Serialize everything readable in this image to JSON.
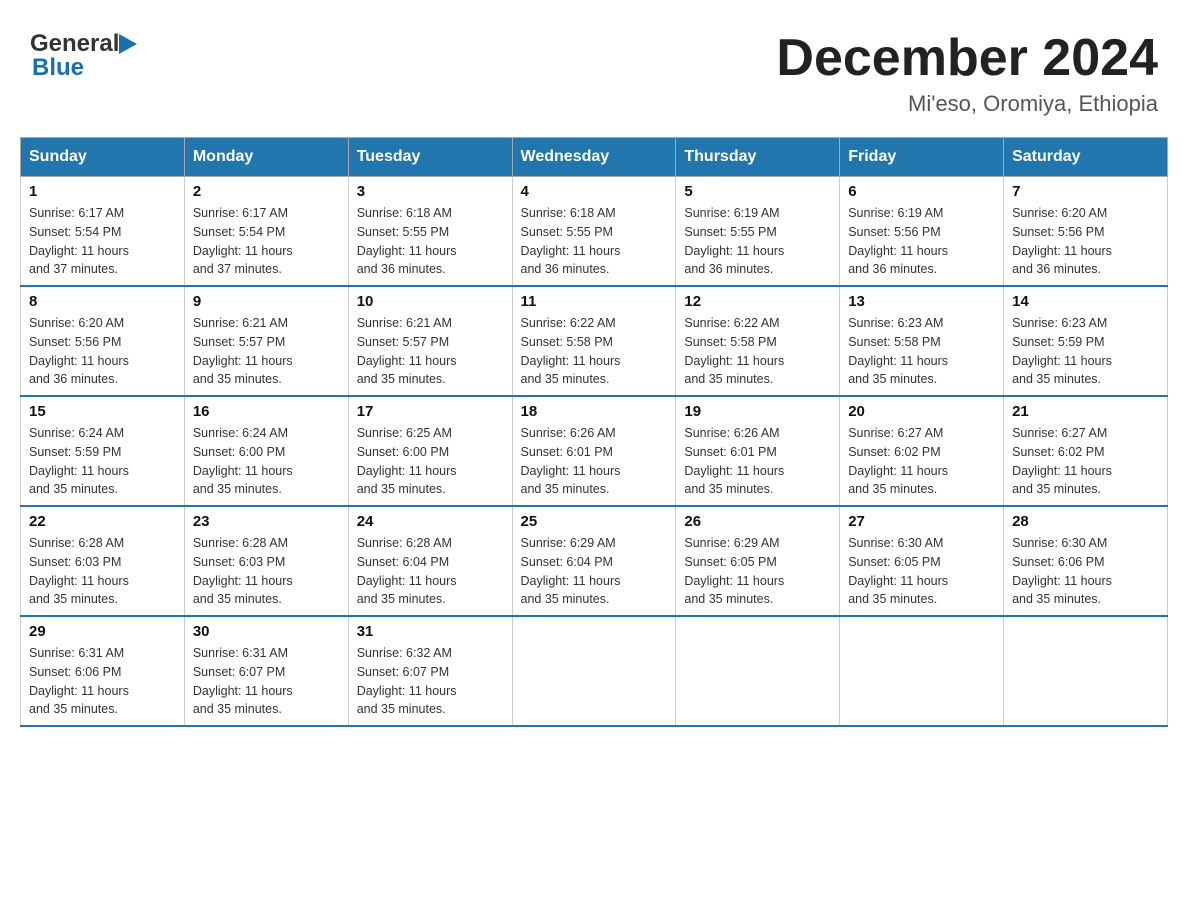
{
  "header": {
    "logo": {
      "general": "General",
      "blue": "Blue"
    },
    "title": "December 2024",
    "subtitle": "Mi'eso, Oromiya, Ethiopia"
  },
  "calendar": {
    "days_of_week": [
      "Sunday",
      "Monday",
      "Tuesday",
      "Wednesday",
      "Thursday",
      "Friday",
      "Saturday"
    ],
    "weeks": [
      [
        {
          "day": "1",
          "sunrise": "6:17 AM",
          "sunset": "5:54 PM",
          "daylight": "11 hours and 37 minutes."
        },
        {
          "day": "2",
          "sunrise": "6:17 AM",
          "sunset": "5:54 PM",
          "daylight": "11 hours and 37 minutes."
        },
        {
          "day": "3",
          "sunrise": "6:18 AM",
          "sunset": "5:55 PM",
          "daylight": "11 hours and 36 minutes."
        },
        {
          "day": "4",
          "sunrise": "6:18 AM",
          "sunset": "5:55 PM",
          "daylight": "11 hours and 36 minutes."
        },
        {
          "day": "5",
          "sunrise": "6:19 AM",
          "sunset": "5:55 PM",
          "daylight": "11 hours and 36 minutes."
        },
        {
          "day": "6",
          "sunrise": "6:19 AM",
          "sunset": "5:56 PM",
          "daylight": "11 hours and 36 minutes."
        },
        {
          "day": "7",
          "sunrise": "6:20 AM",
          "sunset": "5:56 PM",
          "daylight": "11 hours and 36 minutes."
        }
      ],
      [
        {
          "day": "8",
          "sunrise": "6:20 AM",
          "sunset": "5:56 PM",
          "daylight": "11 hours and 36 minutes."
        },
        {
          "day": "9",
          "sunrise": "6:21 AM",
          "sunset": "5:57 PM",
          "daylight": "11 hours and 35 minutes."
        },
        {
          "day": "10",
          "sunrise": "6:21 AM",
          "sunset": "5:57 PM",
          "daylight": "11 hours and 35 minutes."
        },
        {
          "day": "11",
          "sunrise": "6:22 AM",
          "sunset": "5:58 PM",
          "daylight": "11 hours and 35 minutes."
        },
        {
          "day": "12",
          "sunrise": "6:22 AM",
          "sunset": "5:58 PM",
          "daylight": "11 hours and 35 minutes."
        },
        {
          "day": "13",
          "sunrise": "6:23 AM",
          "sunset": "5:58 PM",
          "daylight": "11 hours and 35 minutes."
        },
        {
          "day": "14",
          "sunrise": "6:23 AM",
          "sunset": "5:59 PM",
          "daylight": "11 hours and 35 minutes."
        }
      ],
      [
        {
          "day": "15",
          "sunrise": "6:24 AM",
          "sunset": "5:59 PM",
          "daylight": "11 hours and 35 minutes."
        },
        {
          "day": "16",
          "sunrise": "6:24 AM",
          "sunset": "6:00 PM",
          "daylight": "11 hours and 35 minutes."
        },
        {
          "day": "17",
          "sunrise": "6:25 AM",
          "sunset": "6:00 PM",
          "daylight": "11 hours and 35 minutes."
        },
        {
          "day": "18",
          "sunrise": "6:26 AM",
          "sunset": "6:01 PM",
          "daylight": "11 hours and 35 minutes."
        },
        {
          "day": "19",
          "sunrise": "6:26 AM",
          "sunset": "6:01 PM",
          "daylight": "11 hours and 35 minutes."
        },
        {
          "day": "20",
          "sunrise": "6:27 AM",
          "sunset": "6:02 PM",
          "daylight": "11 hours and 35 minutes."
        },
        {
          "day": "21",
          "sunrise": "6:27 AM",
          "sunset": "6:02 PM",
          "daylight": "11 hours and 35 minutes."
        }
      ],
      [
        {
          "day": "22",
          "sunrise": "6:28 AM",
          "sunset": "6:03 PM",
          "daylight": "11 hours and 35 minutes."
        },
        {
          "day": "23",
          "sunrise": "6:28 AM",
          "sunset": "6:03 PM",
          "daylight": "11 hours and 35 minutes."
        },
        {
          "day": "24",
          "sunrise": "6:28 AM",
          "sunset": "6:04 PM",
          "daylight": "11 hours and 35 minutes."
        },
        {
          "day": "25",
          "sunrise": "6:29 AM",
          "sunset": "6:04 PM",
          "daylight": "11 hours and 35 minutes."
        },
        {
          "day": "26",
          "sunrise": "6:29 AM",
          "sunset": "6:05 PM",
          "daylight": "11 hours and 35 minutes."
        },
        {
          "day": "27",
          "sunrise": "6:30 AM",
          "sunset": "6:05 PM",
          "daylight": "11 hours and 35 minutes."
        },
        {
          "day": "28",
          "sunrise": "6:30 AM",
          "sunset": "6:06 PM",
          "daylight": "11 hours and 35 minutes."
        }
      ],
      [
        {
          "day": "29",
          "sunrise": "6:31 AM",
          "sunset": "6:06 PM",
          "daylight": "11 hours and 35 minutes."
        },
        {
          "day": "30",
          "sunrise": "6:31 AM",
          "sunset": "6:07 PM",
          "daylight": "11 hours and 35 minutes."
        },
        {
          "day": "31",
          "sunrise": "6:32 AM",
          "sunset": "6:07 PM",
          "daylight": "11 hours and 35 minutes."
        },
        null,
        null,
        null,
        null
      ]
    ],
    "labels": {
      "sunrise_prefix": "Sunrise: ",
      "sunset_prefix": "Sunset: ",
      "daylight_prefix": "Daylight: "
    }
  }
}
